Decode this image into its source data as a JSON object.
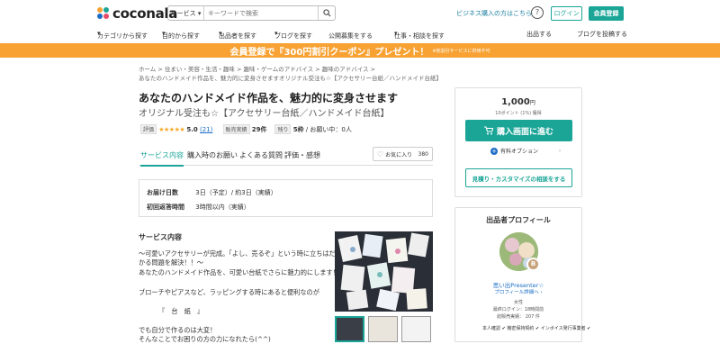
{
  "header": {
    "logo_text": "coconala",
    "search_category": "サービス",
    "search_placeholder": "キーワードで検索",
    "business_link": "ビジネス購入の方はこちら",
    "help": "?",
    "login": "ログイン",
    "register": "会員登録"
  },
  "nav": {
    "items": [
      "カテゴリから探す",
      "目的から探す",
      "出品者を探す",
      "ブログを探す",
      "公開募集をする",
      "仕事・相談を探す"
    ],
    "right_items": [
      "出品する",
      "ブログを投稿する"
    ]
  },
  "banner": {
    "text": "会員登録で『300円割引クーポン』プレゼント！",
    "note": "※他割引サービスに併用不可"
  },
  "breadcrumb": {
    "line1": [
      "ホーム",
      "住まい・美容・生活・趣味",
      "趣味・ゲームのアドバイス",
      "趣味のアドバイス"
    ],
    "line2": "あなたのハンドメイド作品を、魅力的に変身させますオリジナル受注も☆【アクセサリー台紙／ハンドメイド台紙】"
  },
  "service": {
    "title": "あなたのハンドメイド作品を、魅力的に変身させます",
    "subtitle": "オリジナル受注も☆【アクセサリー台紙／ハンドメイド台紙】",
    "rating_label": "評価",
    "stars": "★★★★★",
    "rating": "5.0",
    "review_count": "(21)",
    "sales_label": "販売実績",
    "sales": "29件",
    "remaining_label": "残り",
    "remaining": "5枠",
    "inquiry": "/ お願い中：0人"
  },
  "tabs": [
    "サービス内容",
    "購入時のお願い",
    "よくある質問",
    "評価・感想"
  ],
  "favorite": {
    "label": "お気に入り",
    "count": "380"
  },
  "delivery": {
    "days_label": "お届け日数",
    "days_value": "3日（予定）/ 約3日（実績）",
    "reply_label": "初回返答時間",
    "reply_value": "3時間以内（実績）"
  },
  "content": {
    "heading": "サービス内容",
    "lines": [
      "〜可愛いアクセサリーが完成。「よし、売るぞ」という時に立ちはだ",
      "かる問題を解決！！〜",
      "あなたのハンドメイド作品を、可愛い台紙でさらに魅力的にします！",
      "ブローチやピアスなど、ラッピングする時にあると便利なのが",
      "『　台　紙　』",
      "でも自分で作るのは大変！",
      "そんなことでお困りの方の力になれたら(^^)"
    ]
  },
  "purchase": {
    "price": "1,000",
    "price_unit": "円",
    "points": "10ポイント (1%) 獲得",
    "buy_button": "購入画面に進む",
    "option_label": "有料オプション",
    "quote_button": "見積り・カスタマイズの相談をする"
  },
  "profile": {
    "heading": "出品者プロフィール",
    "badge": "B",
    "name": "思い出Presenter☆",
    "link": "プロフィール詳細へ",
    "gender": "女性",
    "last_login": "最終ログイン：18時間前",
    "total_sales": "総販売実績： 207 件",
    "verifications": "本人確認 ✔ 機密保持契約 ✔ インボイス発行事業者 ✔"
  },
  "colors": {
    "accent": "#1aa597",
    "banner": "#f7a233",
    "link": "#1a6cc5",
    "star": "#f5a623"
  }
}
